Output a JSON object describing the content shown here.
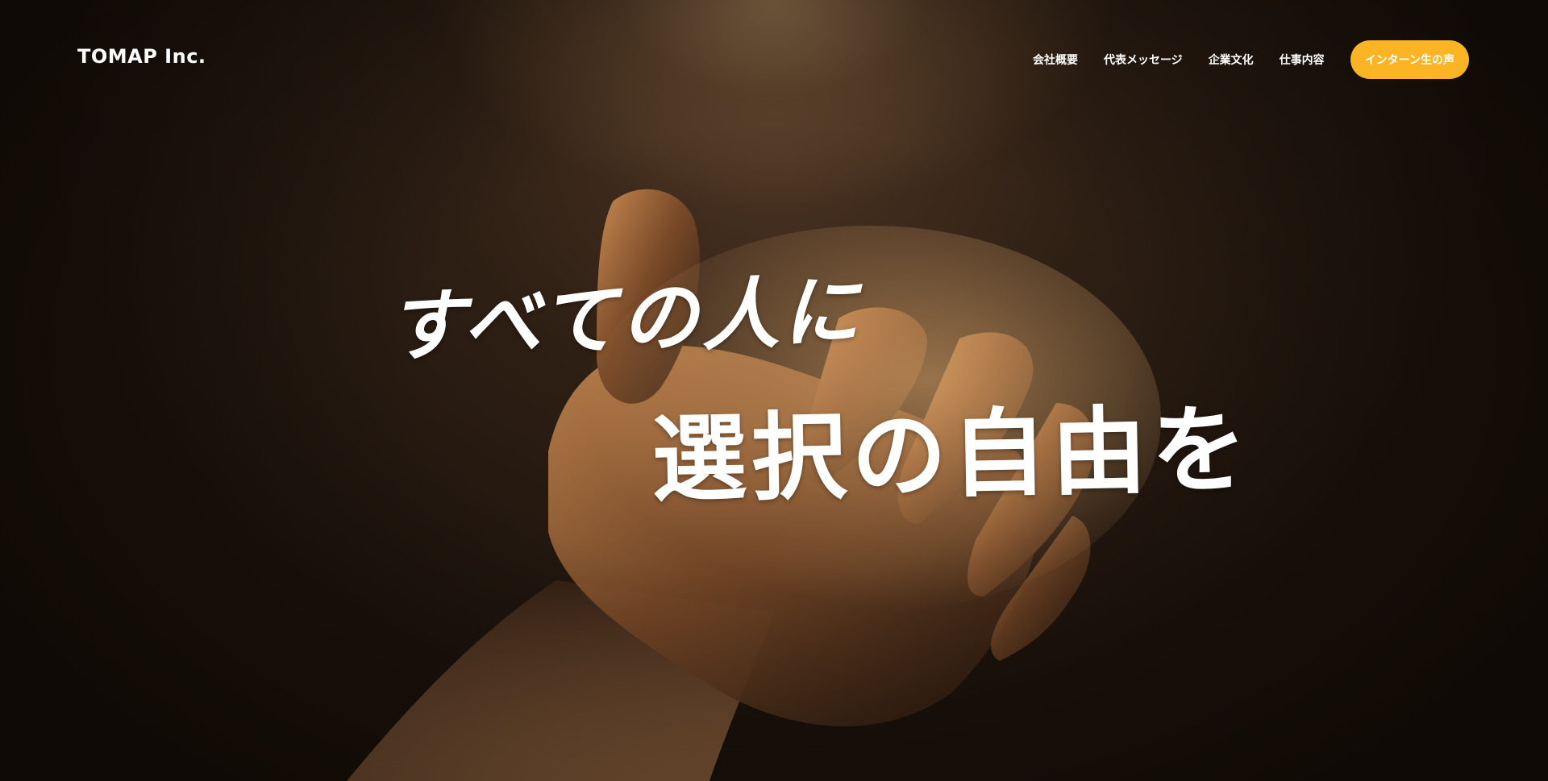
{
  "header": {
    "logo": "TOMAP Inc.",
    "nav": [
      {
        "label": "会社概要"
      },
      {
        "label": "代表メッセージ"
      },
      {
        "label": "企業文化"
      },
      {
        "label": "仕事内容"
      }
    ],
    "cta_label": "インターン生の声"
  },
  "hero": {
    "headline_line1": "すべての人に",
    "headline_line2": "選択の自由を",
    "background_image": "hand-reaching-toward-light"
  },
  "colors": {
    "accent": "#fbb424",
    "text": "#ffffff",
    "background": "#1a110b"
  }
}
